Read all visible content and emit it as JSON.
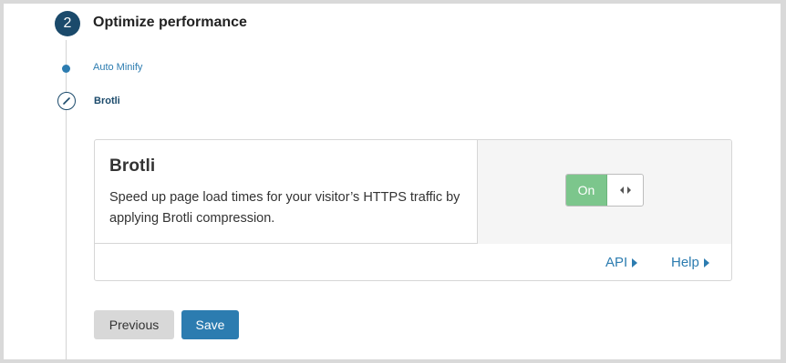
{
  "step": {
    "number": "2",
    "title": "Optimize performance"
  },
  "substeps": {
    "previous_label": "Auto Minify",
    "current_label": "Brotli"
  },
  "card": {
    "title": "Brotli",
    "description": "Speed up page load times for your visitor’s HTTPS traffic by applying Brotli compression.",
    "toggle_label": "On",
    "toggle_state": "on",
    "links": {
      "api_label": "API",
      "help_label": "Help"
    }
  },
  "buttons": {
    "previous_label": "Previous",
    "save_label": "Save"
  },
  "colors": {
    "accent": "#2c7cb0",
    "step_circle": "#1b4a6b",
    "toggle_on": "#7cc68c",
    "secondary_button": "#d8d8d8"
  },
  "icons": {
    "step_edit": "pencil-icon",
    "toggle_handle": "drag-handle-icon",
    "link_arrow": "caret-right-icon"
  }
}
